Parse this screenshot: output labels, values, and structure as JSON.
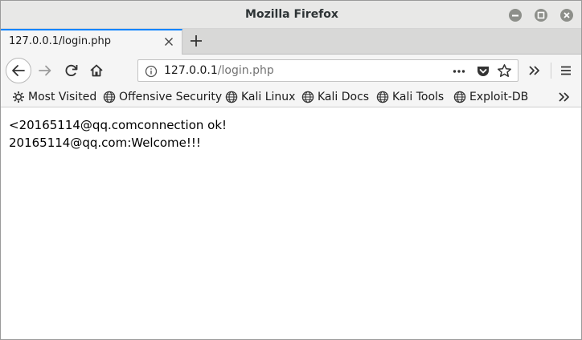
{
  "window": {
    "title": "Mozilla Firefox"
  },
  "tabs": [
    {
      "title": "127.0.0.1/login.php",
      "active": true
    }
  ],
  "urlbar": {
    "host": "127.0.0.1",
    "path": "/login.php"
  },
  "bookmarks": [
    {
      "label": "Most Visited",
      "icon": "gear-icon"
    },
    {
      "label": "Offensive Security",
      "icon": "globe-icon"
    },
    {
      "label": "Kali Linux",
      "icon": "globe-icon"
    },
    {
      "label": "Kali Docs",
      "icon": "globe-icon"
    },
    {
      "label": "Kali Tools",
      "icon": "globe-icon"
    },
    {
      "label": "Exploit-DB",
      "icon": "globe-icon"
    }
  ],
  "content": {
    "lines": [
      "<20165114@qq.comconnection ok!",
      "20165114@qq.com:Welcome!!!"
    ]
  },
  "colors": {
    "accent": "#0a84ff",
    "titlebar": "#e8e8e7",
    "toolbar": "#f5f5f5"
  }
}
